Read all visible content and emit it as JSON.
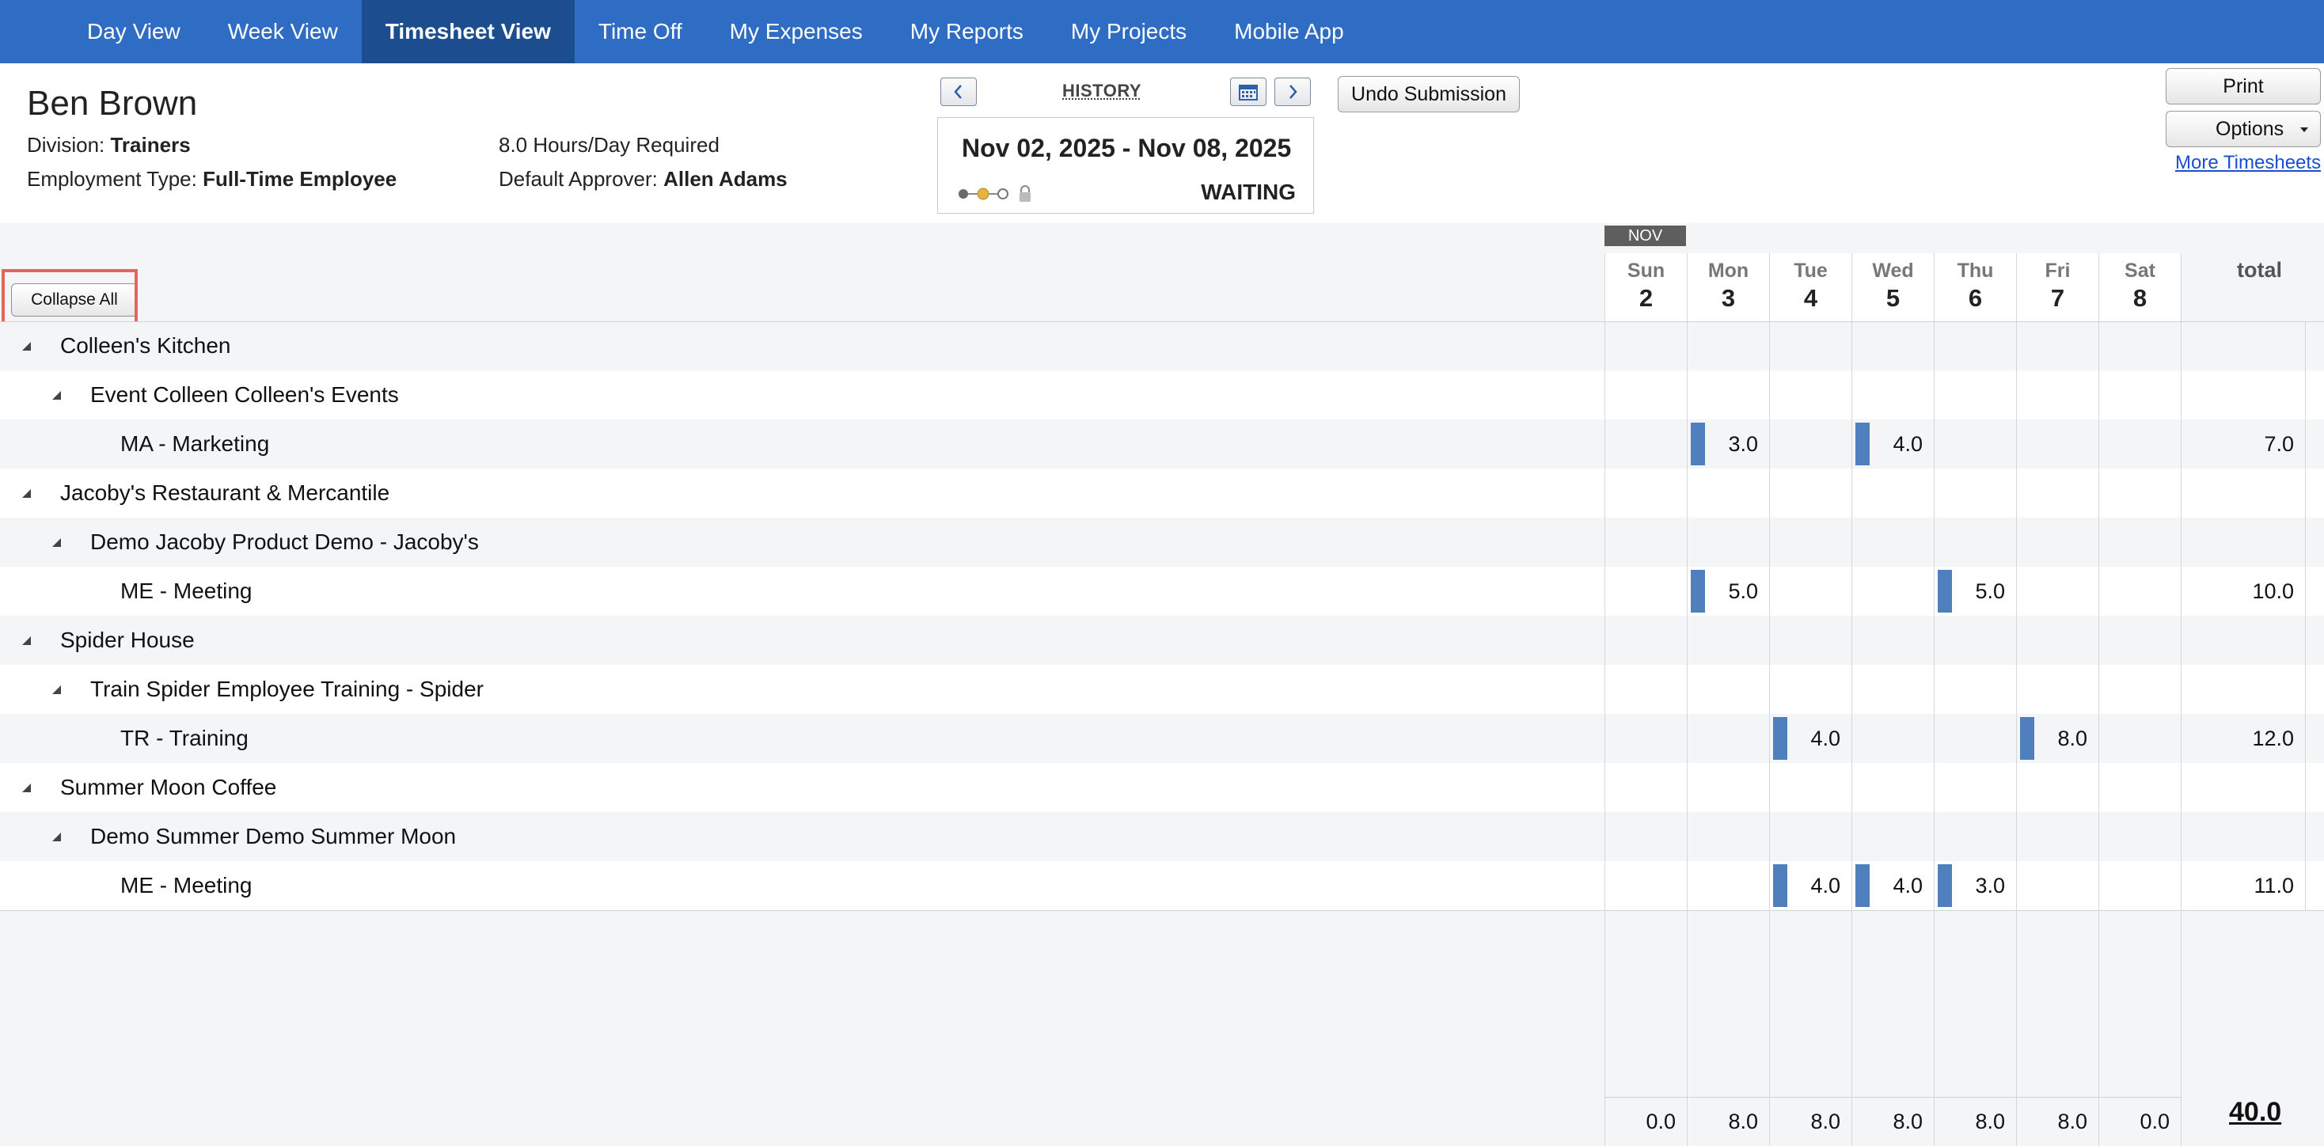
{
  "nav": {
    "tabs": [
      {
        "label": "Day View"
      },
      {
        "label": "Week View"
      },
      {
        "label": "Timesheet View"
      },
      {
        "label": "Time Off"
      },
      {
        "label": "My Expenses"
      },
      {
        "label": "My Reports"
      },
      {
        "label": "My Projects"
      },
      {
        "label": "Mobile App"
      }
    ],
    "active": "Timesheet View"
  },
  "employee": {
    "name": "Ben Brown",
    "division_label": "Division:",
    "division": "Trainers",
    "employment_label": "Employment Type:",
    "employment_type": "Full-Time Employee",
    "hours_required": "8.0 Hours/Day Required",
    "approver_label": "Default Approver:",
    "approver": "Allen Adams"
  },
  "period": {
    "history_label": "HISTORY",
    "range": "Nov 02, 2025 - Nov 08, 2025",
    "status": "WAITING",
    "prev_icon": "chevron-left-icon",
    "next_icon": "chevron-right-icon",
    "calendar_icon": "calendar-icon"
  },
  "buttons": {
    "undo_submission": "Undo Submission",
    "print": "Print",
    "options": "Options",
    "more_timesheets": "More Timesheets",
    "collapse_all": "Collapse All"
  },
  "grid": {
    "month": "NOV",
    "days": [
      {
        "name": "Sun",
        "date": "2"
      },
      {
        "name": "Mon",
        "date": "3"
      },
      {
        "name": "Tue",
        "date": "4"
      },
      {
        "name": "Wed",
        "date": "5"
      },
      {
        "name": "Thu",
        "date": "6"
      },
      {
        "name": "Fri",
        "date": "7"
      },
      {
        "name": "Sat",
        "date": "8"
      }
    ],
    "total_label": "total",
    "rows": [
      {
        "level": 0,
        "label": "Colleen's Kitchen",
        "values": [
          "",
          "",
          "",
          "",
          "",
          "",
          ""
        ],
        "total": ""
      },
      {
        "level": 1,
        "label": "Event Colleen Colleen's Events",
        "values": [
          "",
          "",
          "",
          "",
          "",
          "",
          ""
        ],
        "total": ""
      },
      {
        "level": 2,
        "label": "MA - Marketing",
        "values": [
          "",
          "3.0",
          "",
          "4.0",
          "",
          "",
          ""
        ],
        "total": "7.0"
      },
      {
        "level": 0,
        "label": "Jacoby's Restaurant & Mercantile",
        "values": [
          "",
          "",
          "",
          "",
          "",
          "",
          ""
        ],
        "total": ""
      },
      {
        "level": 1,
        "label": "Demo Jacoby Product Demo - Jacoby's",
        "values": [
          "",
          "",
          "",
          "",
          "",
          "",
          ""
        ],
        "total": ""
      },
      {
        "level": 2,
        "label": "ME - Meeting",
        "values": [
          "",
          "5.0",
          "",
          "",
          "5.0",
          "",
          ""
        ],
        "total": "10.0"
      },
      {
        "level": 0,
        "label": "Spider House",
        "values": [
          "",
          "",
          "",
          "",
          "",
          "",
          ""
        ],
        "total": ""
      },
      {
        "level": 1,
        "label": "Train Spider Employee Training - Spider",
        "values": [
          "",
          "",
          "",
          "",
          "",
          "",
          ""
        ],
        "total": ""
      },
      {
        "level": 2,
        "label": "TR - Training",
        "values": [
          "",
          "",
          "4.0",
          "",
          "",
          "8.0",
          ""
        ],
        "total": "12.0"
      },
      {
        "level": 0,
        "label": "Summer Moon Coffee",
        "values": [
          "",
          "",
          "",
          "",
          "",
          "",
          ""
        ],
        "total": ""
      },
      {
        "level": 1,
        "label": "Demo Summer Demo Summer Moon",
        "values": [
          "",
          "",
          "",
          "",
          "",
          "",
          ""
        ],
        "total": ""
      },
      {
        "level": 2,
        "label": "ME - Meeting",
        "values": [
          "",
          "",
          "4.0",
          "4.0",
          "3.0",
          "",
          ""
        ],
        "total": "11.0"
      }
    ],
    "day_totals": [
      "0.0",
      "8.0",
      "8.0",
      "8.0",
      "8.0",
      "8.0",
      "0.0"
    ],
    "grand_total": "40.0"
  },
  "colors": {
    "nav_bg": "#2f6cc3",
    "nav_active": "#1c4d8f",
    "hours_bar": "#4f80bd",
    "highlight": "#e0675a"
  }
}
